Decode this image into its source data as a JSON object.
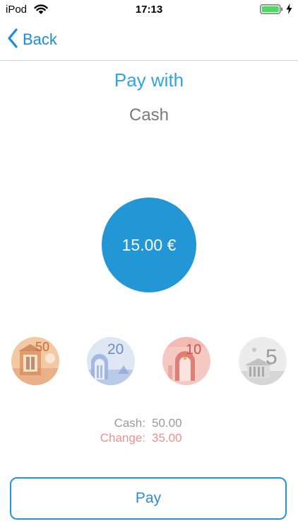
{
  "status_bar": {
    "carrier": "iPod",
    "time": "17:13",
    "battery_color": "#4cd964"
  },
  "nav": {
    "back_label": "Back",
    "accent_color": "#1a8ce0"
  },
  "header": {
    "title": "Pay with",
    "method": "Cash"
  },
  "amount": {
    "display": "15.00 €",
    "circle_color": "#2396d6"
  },
  "banknotes": [
    {
      "denomination": "50",
      "icon": "euro-50-banknote-icon",
      "color": "#e8a36a"
    },
    {
      "denomination": "20",
      "icon": "euro-20-banknote-icon",
      "color": "#8ea9d8"
    },
    {
      "denomination": "10",
      "icon": "euro-10-banknote-icon",
      "color": "#e48a80"
    },
    {
      "denomination": "5",
      "icon": "euro-5-banknote-icon",
      "color": "#b9b9b9"
    }
  ],
  "summary": {
    "cash_label": "Cash:",
    "cash_value": "50.00",
    "change_label": "Change:",
    "change_value": "35.00"
  },
  "pay_button": {
    "label": "Pay",
    "color": "#2296d3"
  }
}
